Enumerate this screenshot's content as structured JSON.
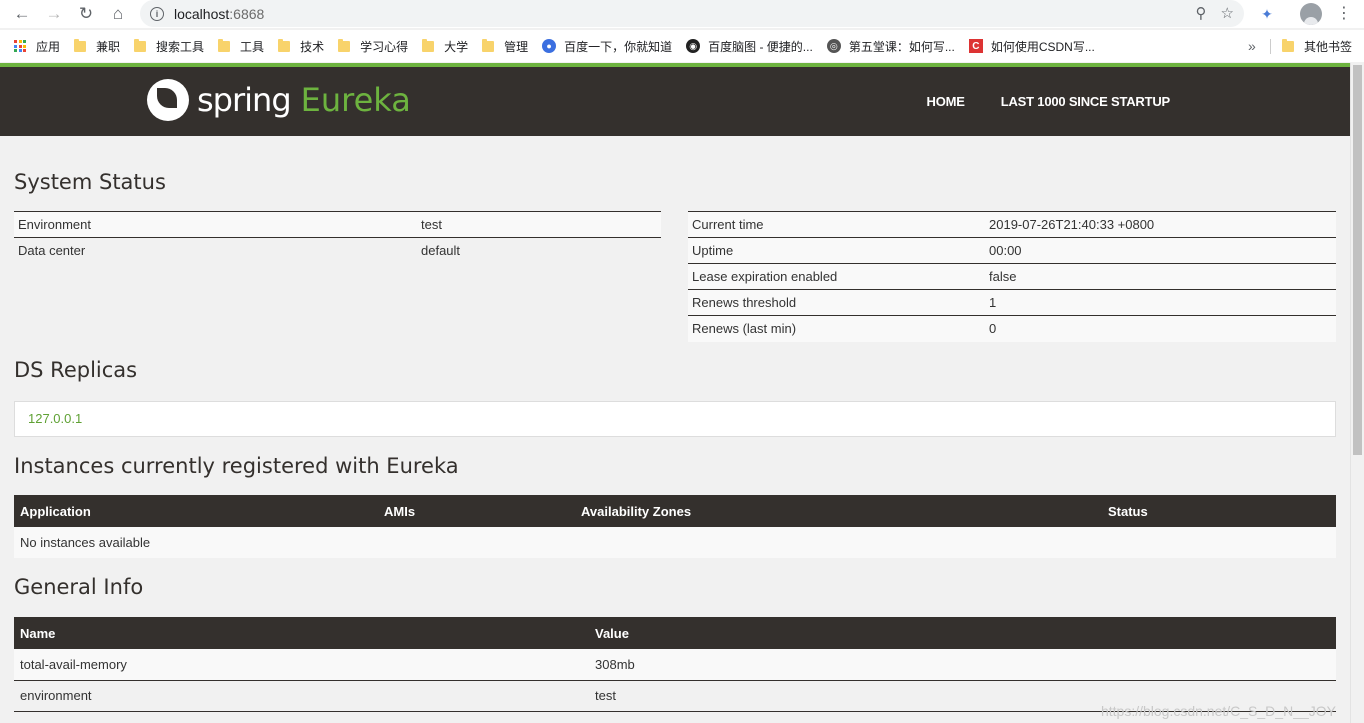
{
  "browser": {
    "url_host": "localhost",
    "url_port": ":6868"
  },
  "bookmarks": {
    "apps": "应用",
    "items": [
      "兼职",
      "搜索工具",
      "工具",
      "技术",
      "学习心得",
      "大学",
      "管理"
    ],
    "baidu": "百度一下，你就知道",
    "naotu": "百度脑图 - 便捷的...",
    "lesson": "第五堂课：如何写...",
    "csdn": "如何使用CSDN写...",
    "more": "»",
    "other": "其他书签"
  },
  "header": {
    "logo_spring": "spring",
    "logo_eureka": "Eureka",
    "nav_home": "HOME",
    "nav_last": "LAST 1000 SINCE STARTUP"
  },
  "system_status": {
    "title": "System Status",
    "left": [
      {
        "label": "Environment",
        "value": "test"
      },
      {
        "label": "Data center",
        "value": "default"
      }
    ],
    "right": [
      {
        "label": "Current time",
        "value": "2019-07-26T21:40:33 +0800"
      },
      {
        "label": "Uptime",
        "value": "00:00"
      },
      {
        "label": "Lease expiration enabled",
        "value": "false"
      },
      {
        "label": "Renews threshold",
        "value": "1"
      },
      {
        "label": "Renews (last min)",
        "value": "0"
      }
    ]
  },
  "ds_replicas": {
    "title": "DS Replicas",
    "replica": "127.0.0.1"
  },
  "instances": {
    "title": "Instances currently registered with Eureka",
    "headers": [
      "Application",
      "AMIs",
      "Availability Zones",
      "Status"
    ],
    "empty": "No instances available"
  },
  "general_info": {
    "title": "General Info",
    "headers": [
      "Name",
      "Value"
    ],
    "rows": [
      {
        "name": "total-avail-memory",
        "value": "308mb"
      },
      {
        "name": "environment",
        "value": "test"
      }
    ]
  },
  "watermark": "https://blog.csdn.net/C_S_D_N__JOY",
  "colors": {
    "accent": "#6db33f",
    "header": "#34302d"
  }
}
